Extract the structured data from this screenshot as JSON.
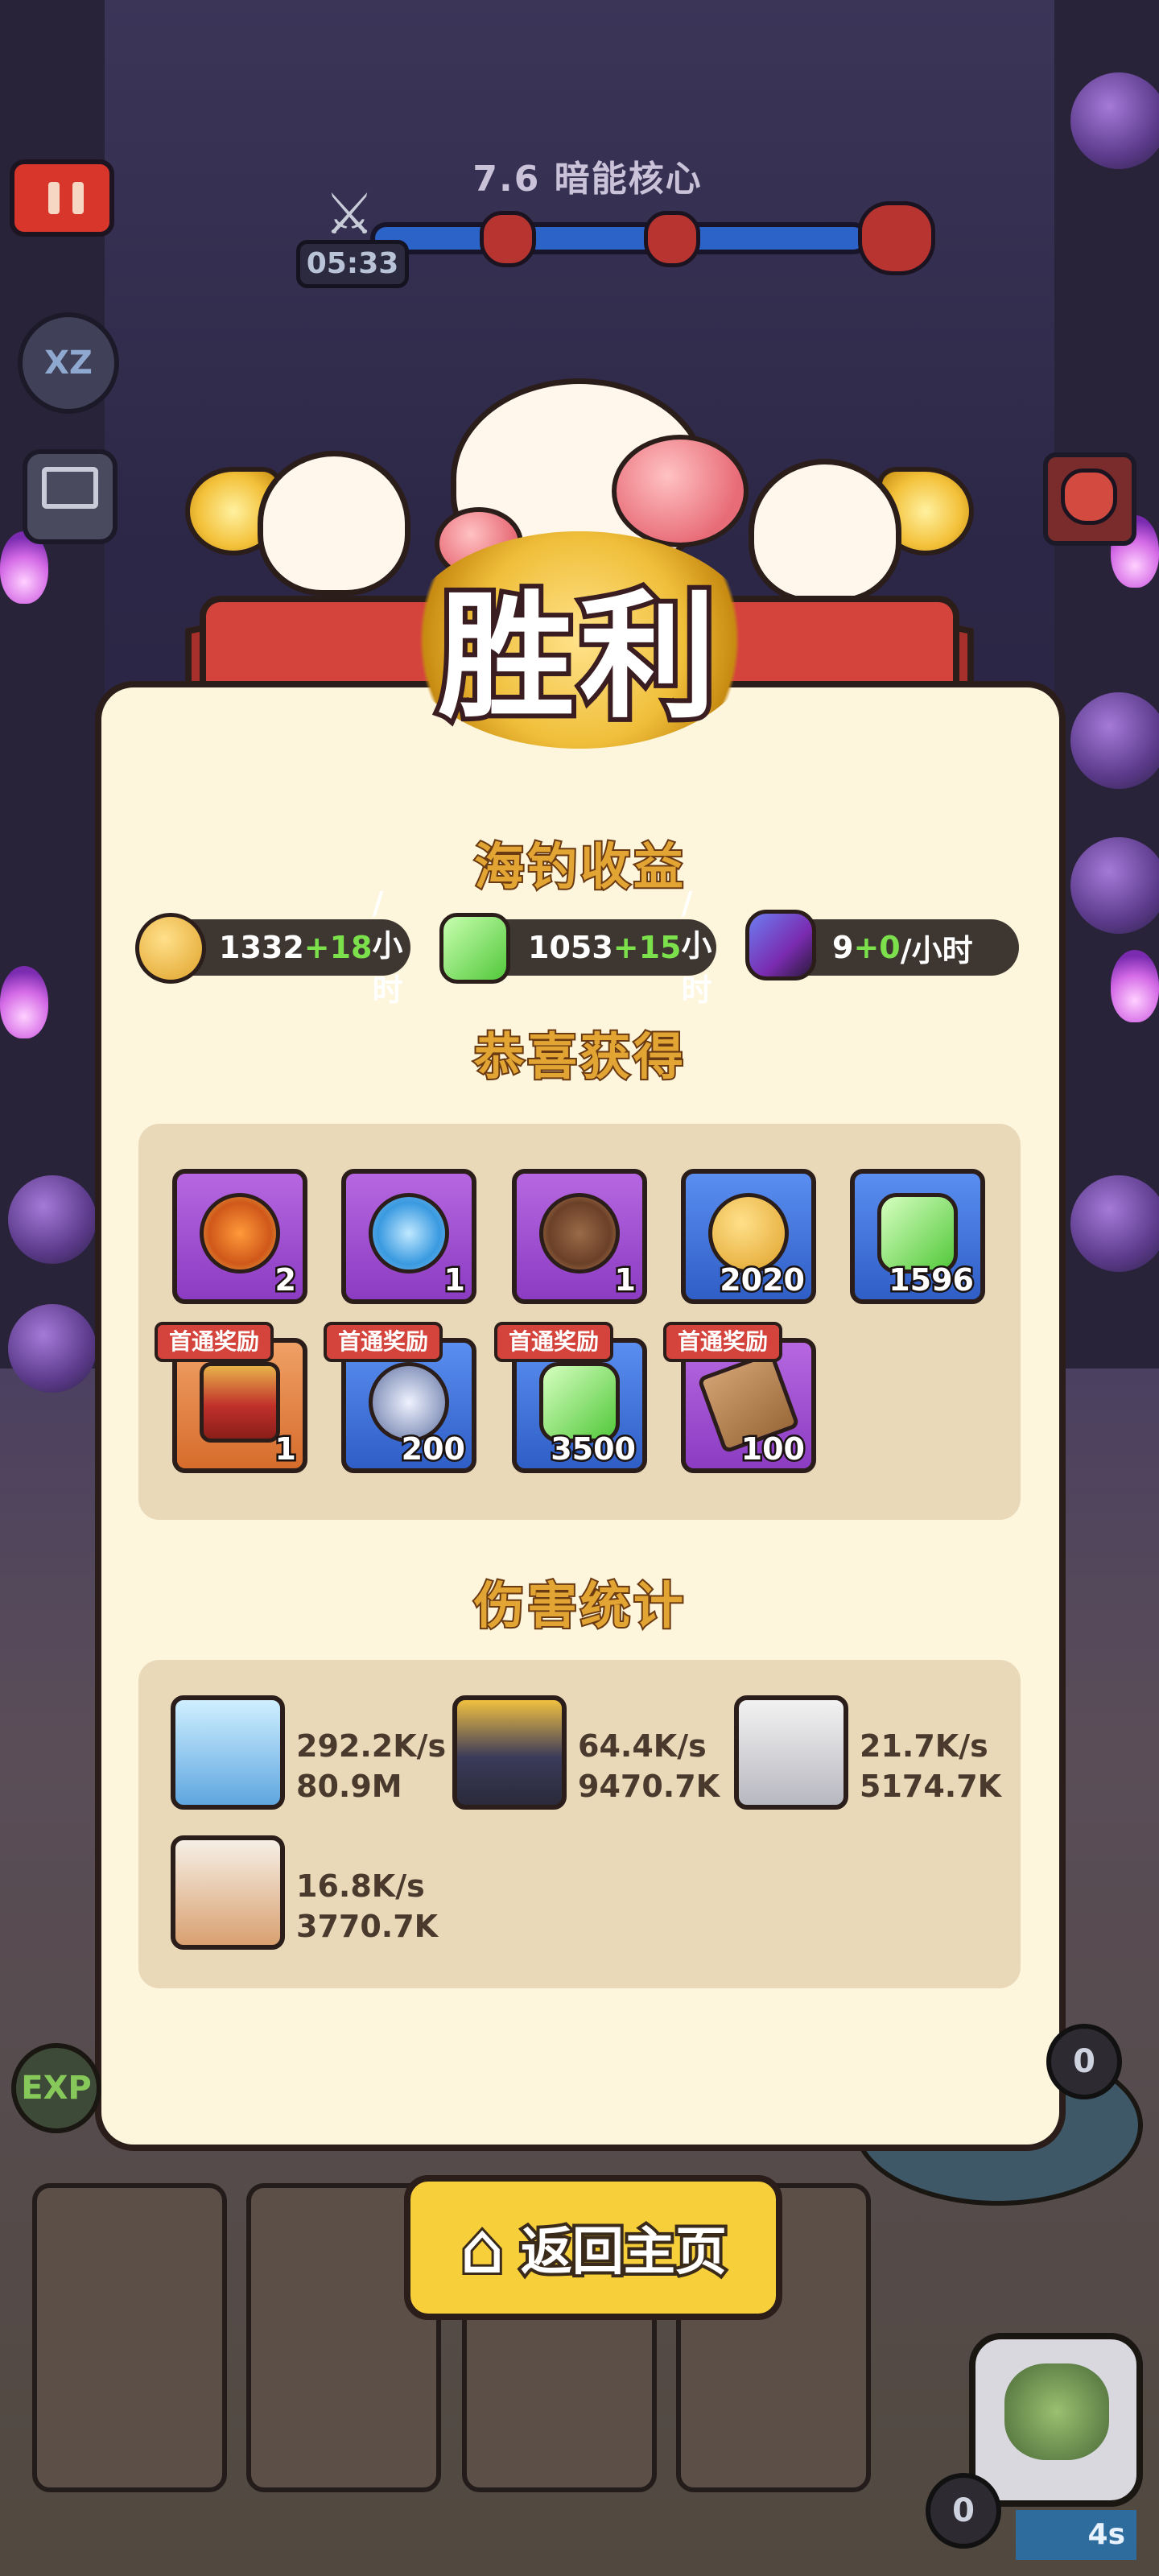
{
  "hud": {
    "level_title": "7.6 暗能核心",
    "timer": "05:33",
    "speed_label": "XZ",
    "swords_icon": "crossed-swords-icon"
  },
  "victory": {
    "title": "胜利"
  },
  "fishing": {
    "title": "海钓收益",
    "rates": [
      {
        "icon": "cat-coin-icon",
        "base": "1332",
        "inc": "+18",
        "unit": "/小时"
      },
      {
        "icon": "exp-gem-icon",
        "base": "1053",
        "inc": "+15",
        "unit": "/小时"
      },
      {
        "icon": "dark-crystal-icon",
        "base": "9",
        "inc": "+0",
        "unit": "/小时"
      }
    ]
  },
  "rewards": {
    "title": "恭喜获得",
    "items": [
      {
        "icon": "fire-gem-icon",
        "count": "2",
        "rarity": "purple"
      },
      {
        "icon": "water-gem-icon",
        "count": "1",
        "rarity": "purple"
      },
      {
        "icon": "earth-gem-icon",
        "count": "1",
        "rarity": "purple"
      },
      {
        "icon": "cat-coin-icon",
        "count": "2020",
        "rarity": "blue"
      },
      {
        "icon": "exp-gem-icon",
        "count": "1596",
        "rarity": "blue"
      },
      {
        "icon": "treasure-chest-icon",
        "count": "1",
        "rarity": "orange",
        "badge": "首通奖励"
      },
      {
        "icon": "paw-token-icon",
        "count": "200",
        "rarity": "blue",
        "badge": "首通奖励"
      },
      {
        "icon": "exp-gem-icon",
        "count": "3500",
        "rarity": "blue",
        "badge": "首通奖励"
      },
      {
        "icon": "wood-planks-icon",
        "count": "100",
        "rarity": "purple",
        "badge": "首通奖励"
      }
    ]
  },
  "damage": {
    "title": "伤害统计",
    "heroes": [
      {
        "avatar": "ice-crystal-cat-avatar",
        "dps": "292.2K/s",
        "total": "80.9M"
      },
      {
        "avatar": "golden-warrior-cat-avatar",
        "dps": "64.4K/s",
        "total": "9470.7K"
      },
      {
        "avatar": "knight-cat-avatar",
        "dps": "21.7K/s",
        "total": "5174.7K"
      },
      {
        "avatar": "calico-cat-avatar",
        "dps": "16.8K/s",
        "total": "3770.7K"
      }
    ]
  },
  "bottom": {
    "home_label": "返回主页",
    "exp_label": "EXP",
    "counter_label": "0",
    "side_counter": "0",
    "cooldown": "4s"
  }
}
